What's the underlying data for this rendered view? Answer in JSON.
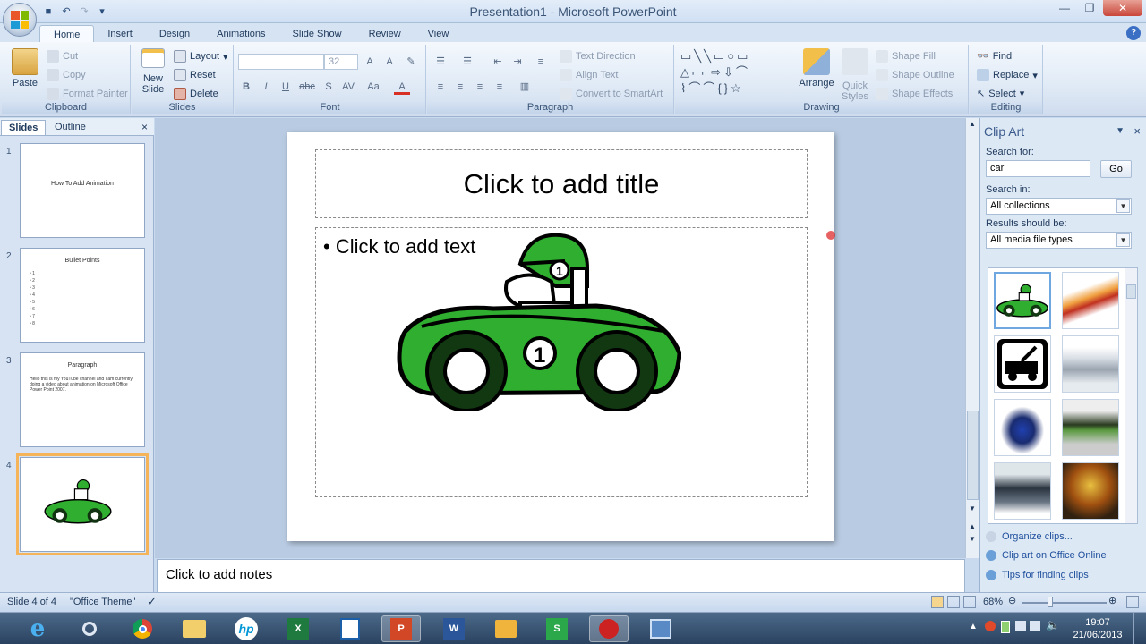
{
  "window": {
    "title": "Presentation1 - Microsoft PowerPoint"
  },
  "tabs": [
    "Home",
    "Insert",
    "Design",
    "Animations",
    "Slide Show",
    "Review",
    "View"
  ],
  "ribbon": {
    "clipboard": {
      "label": "Clipboard",
      "paste": "Paste",
      "cut": "Cut",
      "copy": "Copy",
      "format_painter": "Format Painter"
    },
    "slides": {
      "label": "Slides",
      "new_slide_1": "New",
      "new_slide_2": "Slide",
      "layout": "Layout",
      "reset": "Reset",
      "delete": "Delete"
    },
    "font": {
      "label": "Font",
      "size": "32"
    },
    "paragraph": {
      "label": "Paragraph",
      "text_direction": "Text Direction",
      "align_text": "Align Text",
      "convert_smartart": "Convert to SmartArt"
    },
    "drawing": {
      "label": "Drawing",
      "arrange": "Arrange",
      "quick_styles_1": "Quick",
      "quick_styles_2": "Styles",
      "shape_fill": "Shape Fill",
      "shape_outline": "Shape Outline",
      "shape_effects": "Shape Effects"
    },
    "editing": {
      "label": "Editing",
      "find": "Find",
      "replace": "Replace",
      "select": "Select"
    }
  },
  "pane": {
    "tab_slides": "Slides",
    "tab_outline": "Outline"
  },
  "thumbnails": [
    {
      "num": "1",
      "title": "How To Add Animation"
    },
    {
      "num": "2",
      "title": "Bullet Points",
      "bullets": [
        "1",
        "2",
        "3",
        "4",
        "5",
        "6",
        "7",
        "8"
      ]
    },
    {
      "num": "3",
      "title": "Paragraph",
      "body": "Hello this is my YouTube channel and I am currently doing a video about animation on Microsoft Office Power Point 2007."
    },
    {
      "num": "4"
    }
  ],
  "slide": {
    "title_placeholder": "Click to add title",
    "body_placeholder": "Click to add text"
  },
  "notes": {
    "placeholder": "Click to add notes"
  },
  "clipart": {
    "title": "Clip Art",
    "search_label": "Search for:",
    "search_value": "car",
    "go": "Go",
    "search_in_label": "Search in:",
    "search_in_value": "All collections",
    "results_label": "Results should be:",
    "results_value": "All media file types",
    "links": [
      "Organize clips...",
      "Clip art on Office Online",
      "Tips for finding clips"
    ]
  },
  "status": {
    "slide_info": "Slide 4 of 4",
    "theme": "\"Office Theme\"",
    "zoom": "68%"
  },
  "clock": {
    "time": "19:07",
    "date": "21/06/2013"
  }
}
